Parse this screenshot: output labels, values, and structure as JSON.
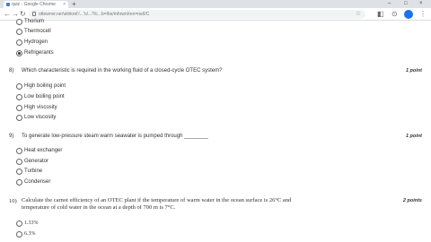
{
  "browser": {
    "tab_title": "quiz - Google Chrome",
    "tab_close": "×",
    "new_tab": "+",
    "url": "ottewnvr.ner\\elnkrel'/...'n/...?/c...b=/ke/mhrwn/ren=ne/l/C",
    "window_controls": [
      "–",
      "□",
      "×"
    ],
    "nav": {
      "back": "←",
      "forward": "→",
      "reload": "↻"
    },
    "star": "☆",
    "menu": "⋮"
  },
  "questions": [
    {
      "number": "",
      "text": "",
      "points": "",
      "options": [
        {
          "label": "Thorium",
          "selected": false
        },
        {
          "label": "Thermocell",
          "selected": false
        },
        {
          "label": "Hydrogen",
          "selected": false
        },
        {
          "label": "Refrigerants",
          "selected": true
        }
      ]
    },
    {
      "number": "8)",
      "text": "Which characteristic is required in the working fluid of a closed-cycle OTEC system?",
      "points": "1 point",
      "options": [
        {
          "label": "High boiling point",
          "selected": false
        },
        {
          "label": "Low boiling point",
          "selected": false
        },
        {
          "label": "High viscosity",
          "selected": false
        },
        {
          "label": "Low viscosity",
          "selected": false
        }
      ]
    },
    {
      "number": "9)",
      "text": "To generate low-pressure steam warm seawater is pumped through ________",
      "points": "1 point",
      "options": [
        {
          "label": "Heat exchanger",
          "selected": false
        },
        {
          "label": "Generator",
          "selected": false
        },
        {
          "label": "Turbine",
          "selected": false
        },
        {
          "label": "Condenser",
          "selected": false
        }
      ]
    },
    {
      "number": "10)",
      "text_line1": "Calculate the carnot efficiency of an OTEC plant if the temperature of warm water in the ocean surface is 26°C and",
      "text_line2": "temperature of cold water in the ocean at a depth of 700 m is 7°C.",
      "points": "2 points",
      "options": [
        {
          "label": "1.33%",
          "selected": false
        },
        {
          "label": "6.3%",
          "selected": false
        }
      ]
    }
  ]
}
